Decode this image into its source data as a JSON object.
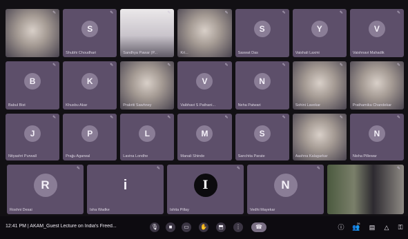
{
  "participants": [
    {
      "name": "",
      "initial": "",
      "photo": "face"
    },
    {
      "name": "Shubhi Choudhari",
      "initial": "S"
    },
    {
      "name": "Sandhya Pawar (P...",
      "initial": "",
      "photo": "screen"
    },
    {
      "name": "Kri...",
      "initial": "",
      "photo": "face"
    },
    {
      "name": "Saswat Das",
      "initial": "S"
    },
    {
      "name": "Vaishali Laxmi",
      "initial": "Y"
    },
    {
      "name": "Vaishnavi Mahadik",
      "initial": "V"
    },
    {
      "name": "Babul Bist",
      "initial": "B"
    },
    {
      "name": "Khusbu Akar",
      "initial": "K"
    },
    {
      "name": "Prakriti Sawhney",
      "initial": "",
      "photo": "face"
    },
    {
      "name": "Vaibhavi S Pathani...",
      "initial": "V"
    },
    {
      "name": "Neha Patwari",
      "initial": "N"
    },
    {
      "name": "Sohini Lavekar",
      "initial": "",
      "photo": "face"
    },
    {
      "name": "Prathamika Chandekar",
      "initial": "",
      "photo": "face"
    },
    {
      "name": "Nityashri Purwall",
      "initial": "J"
    },
    {
      "name": "Prajju Agarwal",
      "initial": "P"
    },
    {
      "name": "Lavina Londhe",
      "initial": "L"
    },
    {
      "name": "Manali Shinde",
      "initial": "M"
    },
    {
      "name": "Sanchita Parate",
      "initial": "S"
    },
    {
      "name": "Aashna Kalagarkar",
      "initial": "",
      "photo": "face"
    },
    {
      "name": "Nisha Pillewar",
      "initial": "N"
    },
    {
      "name": "Roshni Desai",
      "initial": "R"
    },
    {
      "name": "Isha Wadke",
      "initial": "i"
    },
    {
      "name": "Ishita Pillay",
      "initial": "I"
    },
    {
      "name": "Vedhi Mayekar",
      "initial": "N"
    },
    {
      "name": "",
      "initial": "",
      "photo": "room"
    }
  ],
  "toolbar": {
    "time_and_title": "12:41 PM | AKAM_Guest Lecture on India's Freed...",
    "controls": [
      "mic-icon",
      "camera-icon",
      "captions-icon",
      "raise-hand-icon",
      "present-icon",
      "more-icon",
      "end-call-icon"
    ],
    "right_icons": [
      "info-icon",
      "people-icon",
      "chat-icon",
      "activities-icon",
      "lock-icon"
    ],
    "people_badge": "26"
  }
}
